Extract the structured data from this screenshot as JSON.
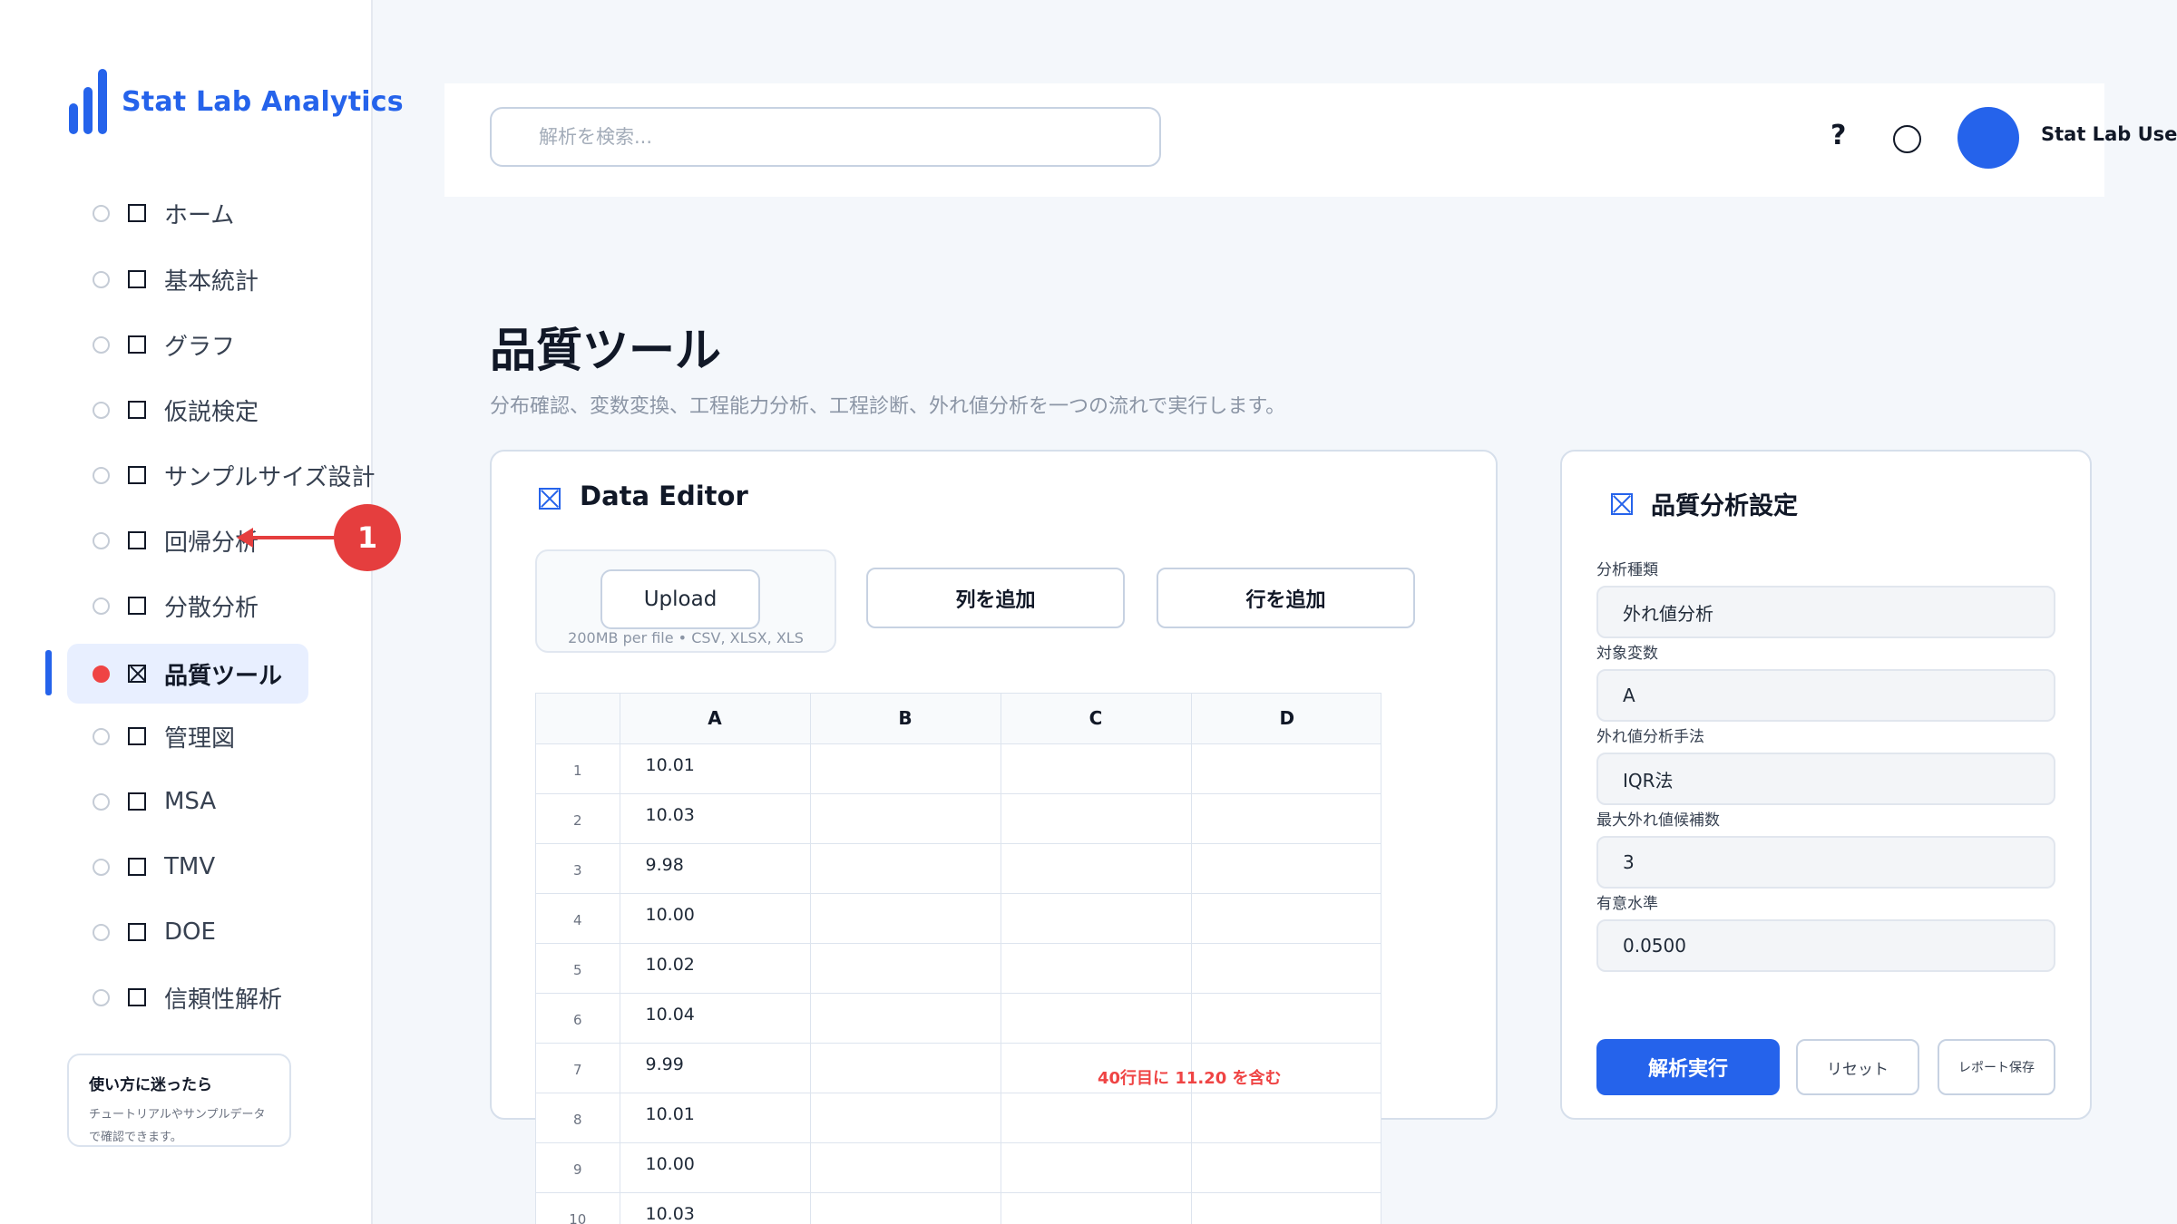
{
  "brand": {
    "name": "Stat Lab Analytics"
  },
  "sidebar": {
    "items": [
      {
        "label": "ホーム",
        "active": false
      },
      {
        "label": "基本統計",
        "active": false
      },
      {
        "label": "グラフ",
        "active": false
      },
      {
        "label": "仮説検定",
        "active": false
      },
      {
        "label": "サンプルサイズ設計",
        "active": false
      },
      {
        "label": "回帰分析",
        "active": false
      },
      {
        "label": "分散分析",
        "active": false
      },
      {
        "label": "品質ツール",
        "active": true
      },
      {
        "label": "管理図",
        "active": false
      },
      {
        "label": "MSA",
        "active": false
      },
      {
        "label": "TMV",
        "active": false
      },
      {
        "label": "DOE",
        "active": false
      },
      {
        "label": "信頼性解析",
        "active": false
      }
    ],
    "help_card": {
      "title": "使い方に迷ったら",
      "text": "チュートリアルやサンプルデータで確認できます。"
    }
  },
  "annotation": {
    "badge": "1"
  },
  "header": {
    "search_placeholder": "解析を検索...",
    "help_label": "?",
    "user_name": "Stat Lab User"
  },
  "page": {
    "title": "品質ツール",
    "subtitle": "分布確認、変数変換、工程能力分析、工程診断、外れ値分析を一つの流れで実行します。"
  },
  "editor": {
    "title": "Data Editor",
    "upload_label": "Upload",
    "upload_hint": "200MB per file • CSV, XLSX, XLS",
    "add_column_label": "列を追加",
    "add_row_label": "行を追加",
    "columns": [
      "A",
      "B",
      "C",
      "D"
    ],
    "rows": [
      {
        "n": "1",
        "a": "10.01"
      },
      {
        "n": "2",
        "a": "10.03"
      },
      {
        "n": "3",
        "a": "9.98"
      },
      {
        "n": "4",
        "a": "10.00"
      },
      {
        "n": "5",
        "a": "10.02"
      },
      {
        "n": "6",
        "a": "10.04"
      },
      {
        "n": "7",
        "a": "9.99"
      },
      {
        "n": "8",
        "a": "10.01"
      },
      {
        "n": "9",
        "a": "10.00"
      },
      {
        "n": "10",
        "a": "10.03"
      }
    ],
    "outlier_note": "40行目に 11.20 を含む"
  },
  "settings": {
    "title": "品質分析設定",
    "fields": [
      {
        "label": "分析種類",
        "value": "外れ値分析"
      },
      {
        "label": "対象変数",
        "value": "A"
      },
      {
        "label": "外れ値分析手法",
        "value": "IQR法"
      },
      {
        "label": "最大外れ値候補数",
        "value": "3"
      },
      {
        "label": "有意水準",
        "value": "0.0500"
      }
    ],
    "run_label": "解析実行",
    "reset_label": "リセット",
    "save_label": "レポート保存"
  },
  "colors": {
    "accent": "#2563eb",
    "alert": "#ef4444"
  }
}
